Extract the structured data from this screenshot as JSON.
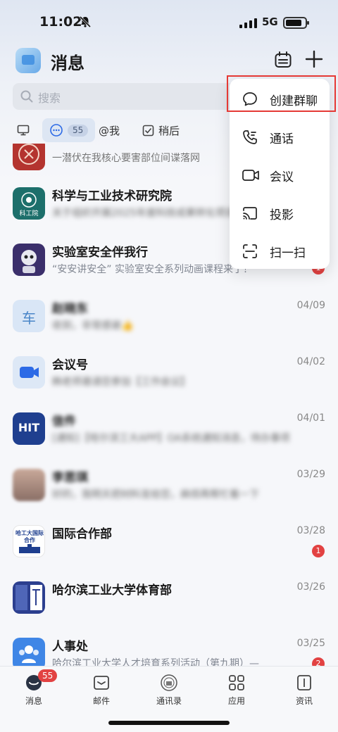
{
  "status_bar": {
    "time": "11:02",
    "network": "5G"
  },
  "header": {
    "title": "消息"
  },
  "search": {
    "placeholder": "搜索"
  },
  "filters": {
    "mentions_label": "@我",
    "later_label": "稍后",
    "chat_count": "55"
  },
  "menu": {
    "items": [
      {
        "label": "创建群聊",
        "icon": "chat-bubble-icon"
      },
      {
        "label": "通话",
        "icon": "phone-icon"
      },
      {
        "label": "会议",
        "icon": "video-camera-icon"
      },
      {
        "label": "投影",
        "icon": "cast-icon"
      },
      {
        "label": "扫一扫",
        "icon": "scan-icon"
      }
    ]
  },
  "conversations": [
    {
      "name": "",
      "preview": "一潜伏在我核心要害部位间谍落网",
      "date": "",
      "badge": ""
    },
    {
      "name": "科学与工业技术研究院",
      "preview": "关于组织开展2025年度科技成果转化项目申报",
      "date": "",
      "badge": ""
    },
    {
      "name": "实验室安全伴我行",
      "preview": "“安安讲安全” 实验室安全系列动画课程来了！",
      "date": "",
      "badge": "1"
    },
    {
      "name": "赵晓东",
      "preview": "收到，非常感谢👍",
      "date": "04/09",
      "badge": ""
    },
    {
      "name": "会议号",
      "preview": "韩老师邀请您参加【工作会议】",
      "date": "04/02",
      "badge": ""
    },
    {
      "name": "信件",
      "preview": "[通知]【哈尔滨工大APP】OA系统通知消息，待办事项",
      "date": "04/01",
      "badge": ""
    },
    {
      "name": "李思琪",
      "preview": "好的，我明天把材料发给您，麻烦再帮忙看一下",
      "date": "03/29",
      "badge": ""
    },
    {
      "name": "国际合作部",
      "preview": "",
      "date": "03/28",
      "badge": "1"
    },
    {
      "name": "哈尔滨工业大学体育部",
      "preview": "",
      "date": "03/26",
      "badge": ""
    },
    {
      "name": "人事处",
      "preview": "哈尔滨工业大学人才培育系列活动（第九期）—",
      "date": "03/25",
      "badge": "2"
    }
  ],
  "avatar_texts": {
    "hit": "HIT",
    "car": "车",
    "research": "科工院",
    "intl": "哈工大国际合作"
  },
  "tabbar": {
    "messages": "消息",
    "messages_badge": "55",
    "mail": "邮件",
    "contacts": "通讯录",
    "apps": "应用",
    "news": "资讯"
  },
  "colors": {
    "accent": "#2c6ae6",
    "badge": "#e24242",
    "highlight_box": "#e53935"
  }
}
